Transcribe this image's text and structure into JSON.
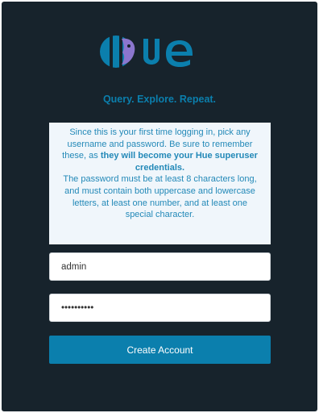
{
  "brand": {
    "logo_text": "HUE",
    "tagline": "Query. Explore. Repeat.",
    "colors": {
      "primary": "#0b7fad",
      "accent_purple": "#8b76ce",
      "background": "#17232c",
      "info_bg": "#f0f6fb",
      "info_text": "#2389b8"
    }
  },
  "info": {
    "line1": "Since this is your first time logging in, pick any username and password. Be sure to remember these, as ",
    "emphasis": "they will become your Hue superuser credentials.",
    "line2": "The password must be at least 8 characters long, and must contain both uppercase and lowercase letters, at least one number, and at least one special character."
  },
  "form": {
    "username_value": "admin",
    "password_value": "••••••••••",
    "submit_label": "Create Account"
  }
}
